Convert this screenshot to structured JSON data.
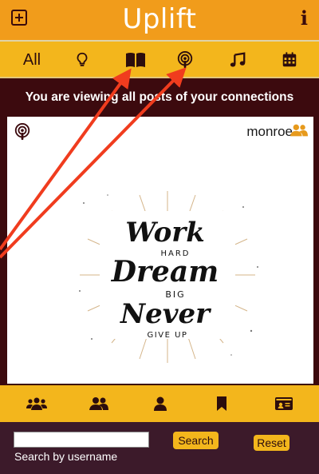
{
  "app": {
    "title": "Uplift"
  },
  "icons": {
    "add": "plus-square-icon",
    "info": "info-icon",
    "category_all": "all",
    "ideas": "lightbulb-icon",
    "books": "open-book-icon",
    "podcasts": "podcast-icon",
    "music": "music-note-icon",
    "events": "calendar-icon"
  },
  "categories": {
    "all_label": "All"
  },
  "banner": {
    "text": "You are viewing all posts of your connections"
  },
  "post": {
    "type_icon": "podcast-icon",
    "username": "monroe",
    "user_icon": "connections-icon",
    "image_text": [
      "Work",
      "HARD",
      "Dream",
      "BIG",
      "Never",
      "GIVE UP"
    ]
  },
  "bottom_nav": [
    {
      "icon": "group-icon"
    },
    {
      "icon": "users-icon"
    },
    {
      "icon": "user-icon"
    },
    {
      "icon": "bookmark-icon"
    },
    {
      "icon": "id-card-icon"
    }
  ],
  "search": {
    "value": "",
    "label": "Search by username",
    "search_label": "Search",
    "reset_label": "Reset"
  },
  "colors": {
    "top_bar": "#f19c1b",
    "category_bar": "#f3b61c",
    "background": "#3c0a0e",
    "search_bar": "#3c1a2a",
    "dark_icon": "#2c0d0d",
    "user_accent": "#e79a1c",
    "annotation_arrow": "#f03c1e"
  }
}
